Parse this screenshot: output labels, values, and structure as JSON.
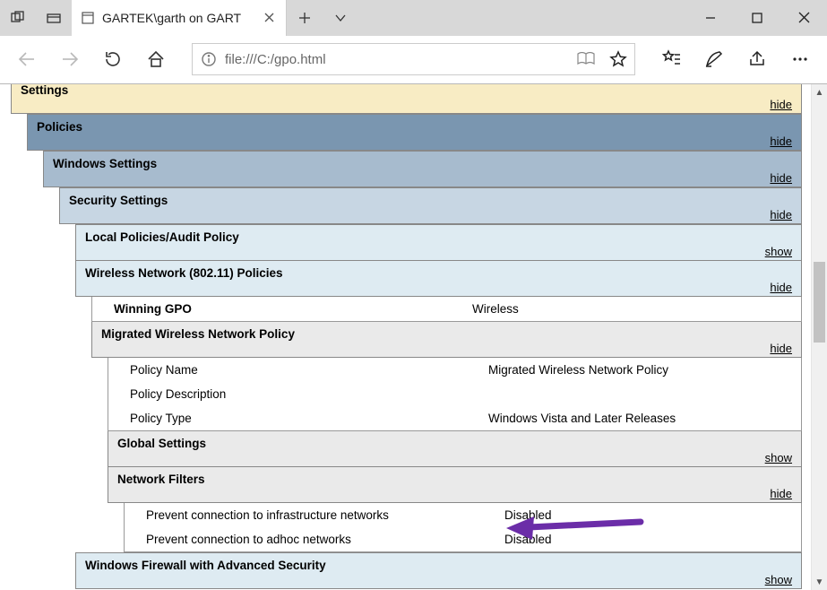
{
  "browser": {
    "tab_title": "GARTEK\\garth on GART",
    "address": "file:///C:/gpo.html"
  },
  "toggles": {
    "hide": "hide",
    "show": "show"
  },
  "report": {
    "l0_partial": "Settings",
    "l1": "Policies",
    "l2": "Windows Settings",
    "l3": "Security Settings",
    "l4a": "Local Policies/Audit Policy",
    "l4b": "Wireless Network (802.11) Policies",
    "winning_gpo_label": "Winning GPO",
    "winning_gpo_value": "Wireless",
    "l5a": "Migrated Wireless Network Policy",
    "policy_name_label": "Policy Name",
    "policy_name_value": "Migrated Wireless Network Policy",
    "policy_desc_label": "Policy Description",
    "policy_desc_value": "",
    "policy_type_label": "Policy Type",
    "policy_type_value": "Windows Vista and Later Releases",
    "l6a": "Global Settings",
    "l6b": "Network Filters",
    "filter1_label": "Prevent connection to infrastructure networks",
    "filter1_value": "Disabled",
    "filter2_label": "Prevent connection to adhoc networks",
    "filter2_value": "Disabled",
    "l4c": "Windows Firewall with Advanced Security"
  }
}
